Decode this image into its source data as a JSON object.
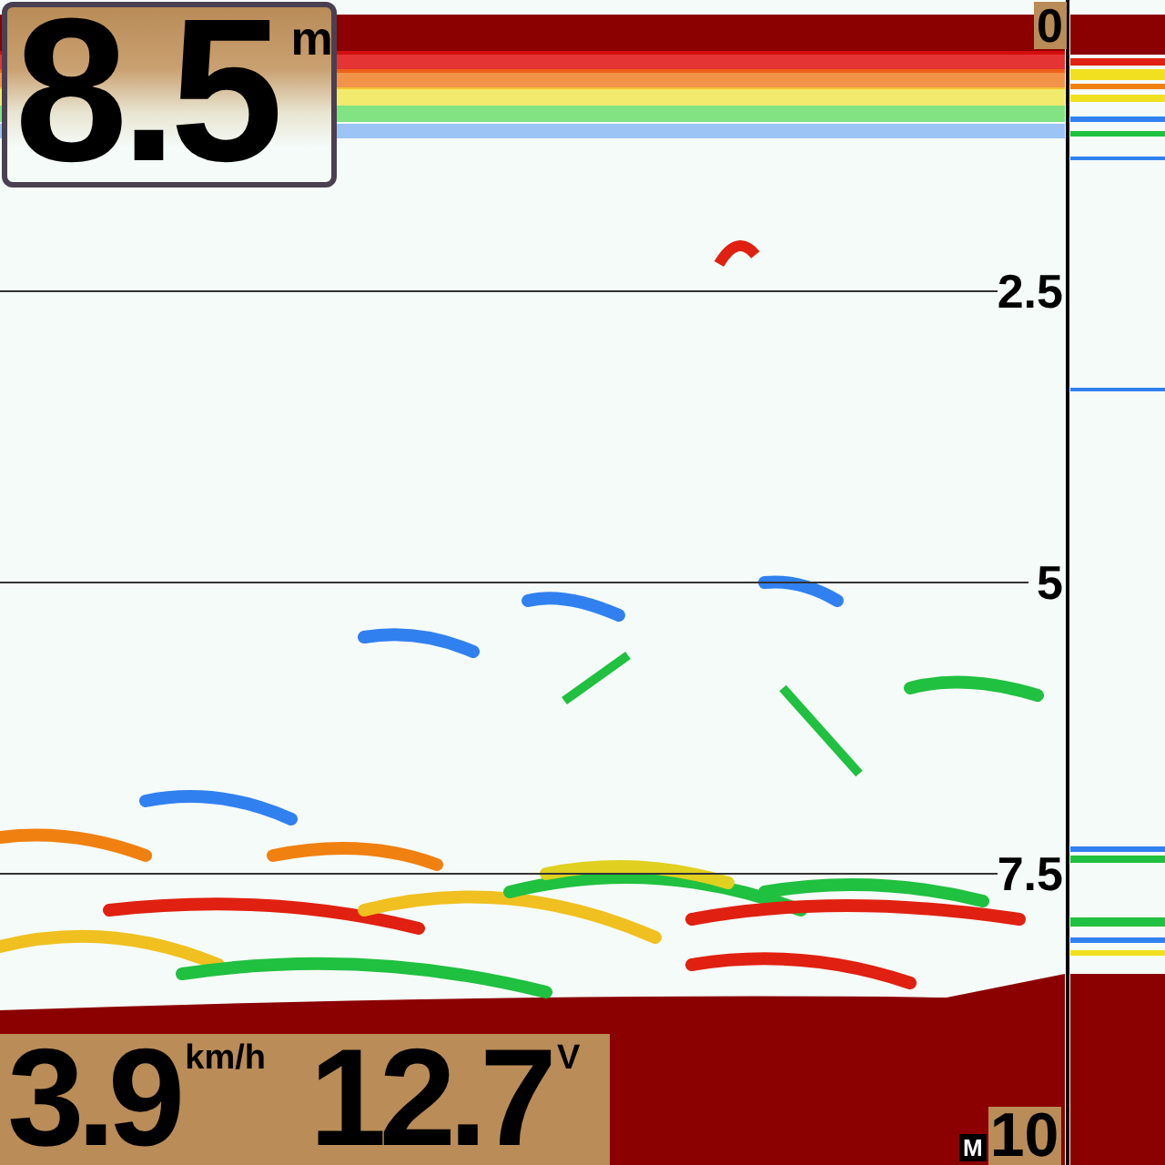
{
  "depth": {
    "value": "8.5",
    "unit": "m"
  },
  "scale": [
    {
      "label": "0"
    },
    {
      "label": "2.5"
    },
    {
      "label": "5"
    },
    {
      "label": "7.5"
    }
  ],
  "speed": {
    "value": "3.9",
    "unit": "km/h"
  },
  "voltage": {
    "value": "12.7",
    "unit": "V"
  },
  "range": {
    "mode": "M",
    "value": "10"
  }
}
